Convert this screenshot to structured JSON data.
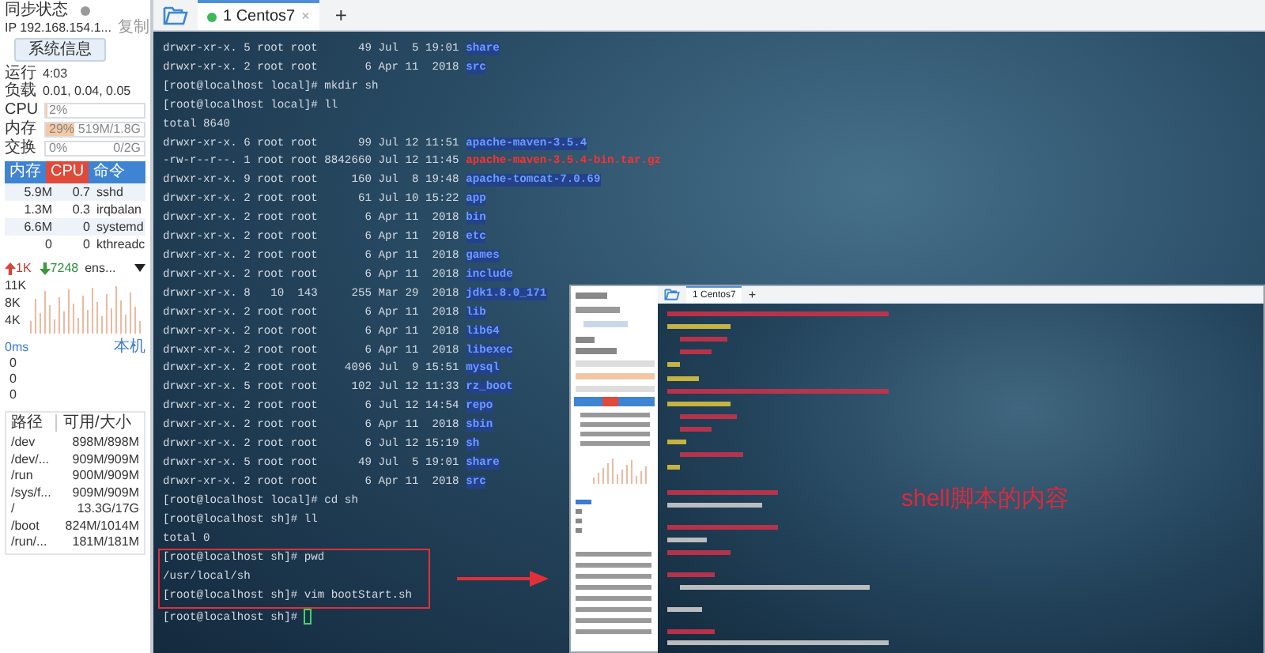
{
  "sidebar": {
    "sync": {
      "label": "同步状态",
      "synced": false
    },
    "ip": "IP 192.168.154.1...",
    "copy_link": "复制",
    "sysinfo_button": "系统信息",
    "stats": [
      {
        "label": "运行",
        "value": "4:03"
      },
      {
        "label": "负载",
        "value": "0.01, 0.04, 0.05"
      }
    ],
    "meters": [
      {
        "label": "CPU",
        "percent": "2%",
        "level": 0.02
      },
      {
        "label": "内存",
        "percent": "29%",
        "reading": "519M/1.8G",
        "level": 0.29
      },
      {
        "label": "交换",
        "percent": "0%",
        "reading": "0/2G",
        "level": 0
      }
    ],
    "process_columns": [
      {
        "label": "内存",
        "selected": false
      },
      {
        "label": "CPU",
        "selected": true
      },
      {
        "label": "命令",
        "selected": false
      }
    ],
    "processes": [
      [
        "5.9M",
        "0.7",
        "sshd"
      ],
      [
        "1.3M",
        "0.3",
        "irqbalan"
      ],
      [
        "6.6M",
        "0",
        "systemd"
      ],
      [
        "0",
        "0",
        "kthreadc"
      ]
    ],
    "network": {
      "upload": "1K",
      "download": "7248",
      "interface": "ens...",
      "axis": [
        "11K",
        "8K",
        "4K"
      ]
    },
    "ping": {
      "latency": "0ms",
      "host": "本机",
      "values": [
        "0",
        "0",
        "0"
      ]
    },
    "disks": {
      "columns": [
        "路径",
        "可用/大小"
      ],
      "rows": [
        [
          "/dev",
          "898M/898M"
        ],
        [
          "/dev/...",
          "909M/909M"
        ],
        [
          "/run",
          "900M/909M"
        ],
        [
          "/sys/f...",
          "909M/909M"
        ],
        [
          "/",
          "13.3G/17G"
        ],
        [
          "/boot",
          "824M/1014M"
        ],
        [
          "/run/...",
          "181M/181M"
        ]
      ]
    }
  },
  "tabs": [
    {
      "label": "1 Centos7",
      "selected": true,
      "connected": true,
      "close": "×"
    }
  ],
  "new_tab": "+",
  "terminal": {
    "lines": [
      {
        "text": "drwxr-xr-x. 5 root root      49 Jul  5 19:01 ",
        "file": "share",
        "kind": "dir"
      },
      {
        "text": "drwxr-xr-x. 2 root root       6 Apr 11  2018 ",
        "file": "src",
        "kind": "dir"
      },
      {
        "text": "[root@localhost local]# mkdir sh"
      },
      {
        "text": "[root@localhost local]# ll"
      },
      {
        "text": "total 8640"
      },
      {
        "text": "drwxr-xr-x. 6 root root      99 Jul 12 11:51 ",
        "file": "apache-maven-3.5.4",
        "kind": "dir"
      },
      {
        "text": "-rw-r--r--. 1 root root 8842660 Jul 12 11:45 ",
        "file": "apache-maven-3.5.4-bin.tar.gz",
        "kind": "archive"
      },
      {
        "text": "drwxr-xr-x. 9 root root     160 Jul  8 19:48 ",
        "file": "apache-tomcat-7.0.69",
        "kind": "dir"
      },
      {
        "text": "drwxr-xr-x. 2 root root      61 Jul 10 15:22 ",
        "file": "app",
        "kind": "dir"
      },
      {
        "text": "drwxr-xr-x. 2 root root       6 Apr 11  2018 ",
        "file": "bin",
        "kind": "dir"
      },
      {
        "text": "drwxr-xr-x. 2 root root       6 Apr 11  2018 ",
        "file": "etc",
        "kind": "dir"
      },
      {
        "text": "drwxr-xr-x. 2 root root       6 Apr 11  2018 ",
        "file": "games",
        "kind": "dir"
      },
      {
        "text": "drwxr-xr-x. 2 root root       6 Apr 11  2018 ",
        "file": "include",
        "kind": "dir"
      },
      {
        "text": "drwxr-xr-x. 8   10  143     255 Mar 29  2018 ",
        "file": "jdk1.8.0_171",
        "kind": "dir"
      },
      {
        "text": "drwxr-xr-x. 2 root root       6 Apr 11  2018 ",
        "file": "lib",
        "kind": "dir"
      },
      {
        "text": "drwxr-xr-x. 2 root root       6 Apr 11  2018 ",
        "file": "lib64",
        "kind": "dir"
      },
      {
        "text": "drwxr-xr-x. 2 root root       6 Apr 11  2018 ",
        "file": "libexec",
        "kind": "dir"
      },
      {
        "text": "drwxr-xr-x. 2 root root    4096 Jul  9 15:51 ",
        "file": "mysql",
        "kind": "dir"
      },
      {
        "text": "drwxr-xr-x. 5 root root     102 Jul 12 11:33 ",
        "file": "rz_boot",
        "kind": "dir"
      },
      {
        "text": "drwxr-xr-x. 2 root root       6 Jul 12 14:54 ",
        "file": "repo",
        "kind": "dir"
      },
      {
        "text": "drwxr-xr-x. 2 root root       6 Apr 11  2018 ",
        "file": "sbin",
        "kind": "dir"
      },
      {
        "text": "drwxr-xr-x. 2 root root       6 Jul 12 15:19 ",
        "file": "sh",
        "kind": "dir"
      },
      {
        "text": "drwxr-xr-x. 5 root root      49 Jul  5 19:01 ",
        "file": "share",
        "kind": "dir"
      },
      {
        "text": "drwxr-xr-x. 2 root root       6 Apr 11  2018 ",
        "file": "src",
        "kind": "dir"
      },
      {
        "text": "[root@localhost local]# cd sh"
      },
      {
        "text": "[root@localhost sh]# ll"
      },
      {
        "text": "total 0"
      },
      {
        "text": "[root@localhost sh]# pwd",
        "boxed": true
      },
      {
        "text": "/usr/local/sh",
        "boxed": true
      },
      {
        "text": "[root@localhost sh]# vim bootStart.sh",
        "boxed": true
      },
      {
        "text": "[root@localhost sh]# ",
        "cursor": true
      }
    ]
  },
  "inset": {
    "tab": "1 Centos7",
    "annotation": "shell脚本的内容",
    "arrow": true
  }
}
